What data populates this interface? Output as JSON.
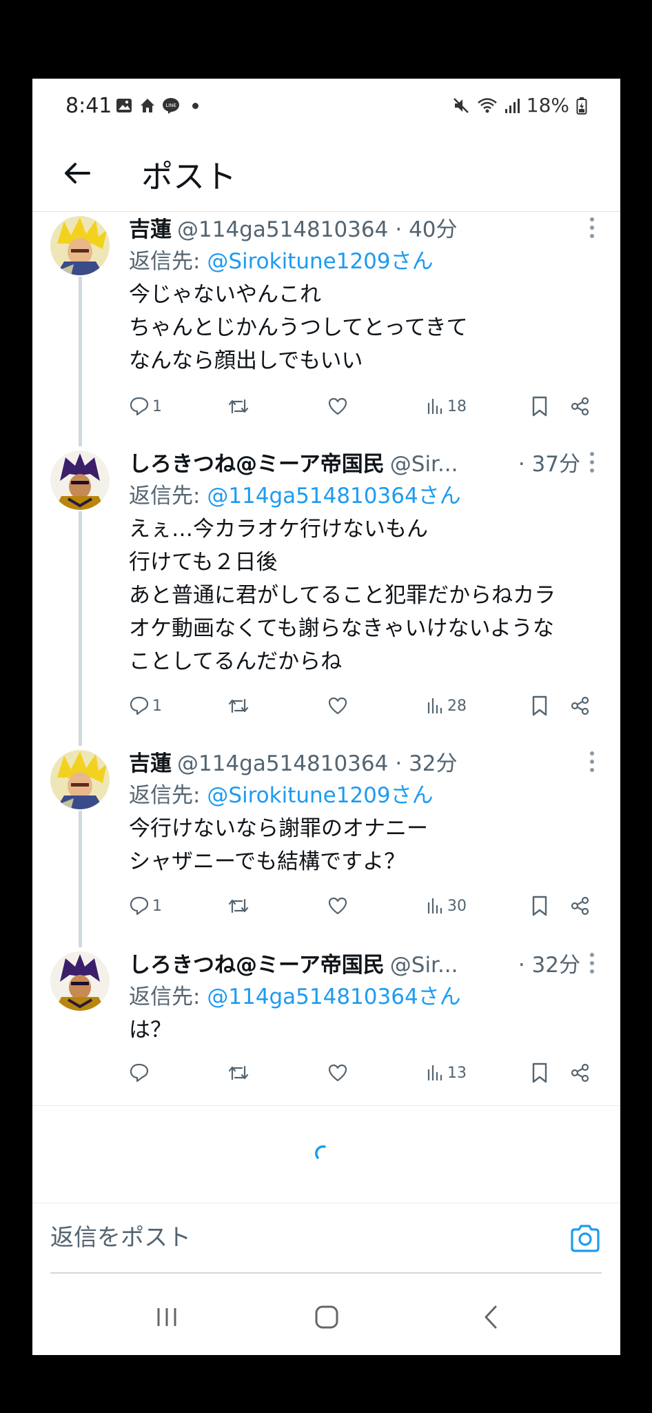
{
  "status_bar": {
    "time": "8:41",
    "battery": "18%",
    "line_badge": "LINE"
  },
  "header": {
    "title": "ポスト"
  },
  "tweets": [
    {
      "name": "吉蓮",
      "handle": "@114ga514810364",
      "time": "· 40分",
      "reply_prefix": "返信先: ",
      "reply_to": "@Sirokitune1209さん",
      "body": "今じゃないやんこれ\nちゃんとじかんうつしてとってきて\nなんなら顔出しでもいい",
      "replies": "1",
      "views": "18"
    },
    {
      "name": "しろきつね@ミーア帝国民",
      "handle": "@Sir...",
      "time": "· 37分",
      "reply_prefix": "返信先: ",
      "reply_to": "@114ga514810364さん",
      "body": "えぇ…今カラオケ行けないもん\n行けても２日後\nあと普通に君がしてること犯罪だからねカラ\nオケ動画なくても謝らなきゃいけないような\nことしてるんだからね",
      "replies": "1",
      "views": "28"
    },
    {
      "name": "吉蓮",
      "handle": "@114ga514810364",
      "time": "· 32分",
      "reply_prefix": "返信先: ",
      "reply_to": "@Sirokitune1209さん",
      "body": "今行けないなら謝罪のオナニー\nシャザニーでも結構ですよ？",
      "replies": "1",
      "views": "30"
    },
    {
      "name": "しろきつね@ミーア帝国民",
      "handle": "@Sir...",
      "time": "· 32分",
      "reply_prefix": "返信先: ",
      "reply_to": "@114ga514810364さん",
      "body": "は？",
      "replies": "",
      "views": "13"
    }
  ],
  "reply_bar": {
    "placeholder": "返信をポスト"
  },
  "colors": {
    "accent": "#1d9bf0",
    "muted": "#536471",
    "text": "#0f1419"
  }
}
